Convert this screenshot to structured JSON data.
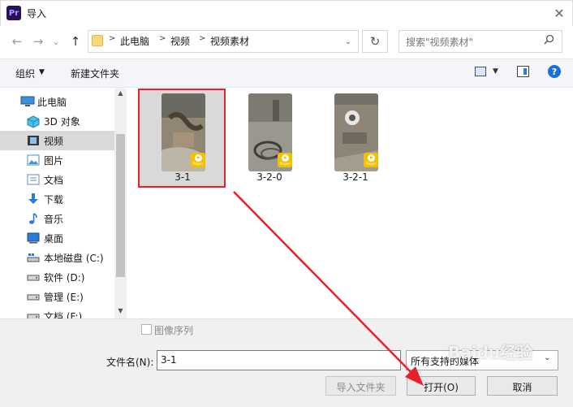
{
  "window": {
    "app_icon_text": "Pr",
    "title": "导入",
    "close_glyph": "✕"
  },
  "nav": {
    "back_glyph": "←",
    "forward_glyph": "→",
    "dropdown_glyph": "⌄",
    "up_glyph": "↑",
    "breadcrumbs": [
      "此电脑",
      "视频",
      "视频素材"
    ],
    "refresh_glyph": "↻",
    "search_placeholder": "搜索\"视频素材\""
  },
  "toolbar": {
    "organize": "组织",
    "dropdown_glyph": "▼",
    "new_folder": "新建文件夹",
    "help": "?"
  },
  "sidebar": {
    "items": [
      {
        "label": "此电脑",
        "icon": "computer-icon"
      },
      {
        "label": "3D 对象",
        "icon": "3d-objects-icon"
      },
      {
        "label": "视频",
        "icon": "videos-icon",
        "selected": true
      },
      {
        "label": "图片",
        "icon": "pictures-icon"
      },
      {
        "label": "文档",
        "icon": "documents-icon"
      },
      {
        "label": "下载",
        "icon": "downloads-icon"
      },
      {
        "label": "音乐",
        "icon": "music-icon"
      },
      {
        "label": "桌面",
        "icon": "desktop-icon"
      },
      {
        "label": "本地磁盘 (C:)",
        "icon": "drive-icon"
      },
      {
        "label": "软件 (D:)",
        "icon": "drive-icon"
      },
      {
        "label": "管理 (E:)",
        "icon": "drive-icon"
      },
      {
        "label": "文档 (F:)",
        "icon": "drive-icon"
      }
    ],
    "scroll_up": "▲",
    "scroll_down": "▼"
  },
  "files": [
    {
      "name": "3-1",
      "badge": "Player",
      "selected": true
    },
    {
      "name": "3-2-0",
      "badge": "Player"
    },
    {
      "name": "3-2-1",
      "badge": "Player"
    }
  ],
  "bottom": {
    "image_sequence_label": "图像序列",
    "filename_label": "文件名(N):",
    "filename_value": "3-1",
    "filter_value": "所有支持的媒体",
    "filter_dd_glyph": "⌄",
    "import_folder_button": "导入文件夹",
    "open_button": "打开(O)",
    "cancel_button": "取消"
  },
  "colors": {
    "selection_border": "#e8202a",
    "arrow": "#e8202a",
    "accent": "#1a6ed8"
  },
  "watermark": "Baidu经验"
}
